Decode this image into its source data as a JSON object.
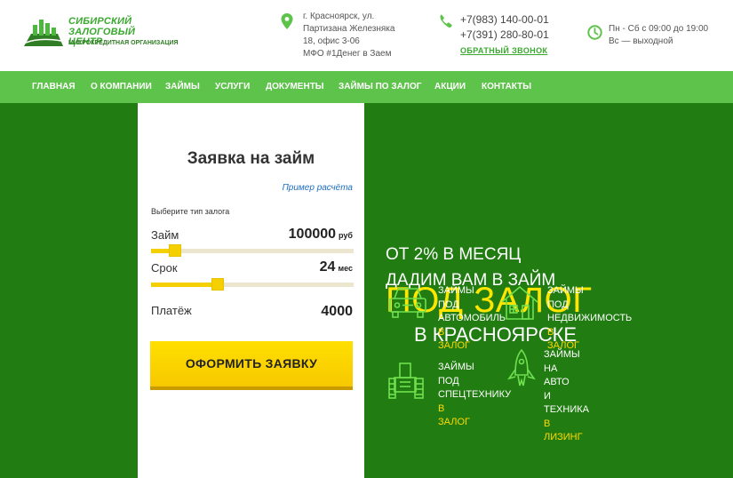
{
  "header": {
    "logo": {
      "line1": "СИБИРСКИЙ",
      "line2": "ЗАЛОГОВЫЙ ЦЕНТР",
      "line3": "МИКРОКРЕДИТНАЯ ОРГАНИЗАЦИЯ"
    },
    "address": {
      "icon": "map-pin-icon",
      "lines": [
        "г. Красноярск, ул.",
        "Партизана Железняка",
        "18, офис 3-06",
        "МФО #1Денег в Заем"
      ]
    },
    "phones": {
      "icon": "phone-icon",
      "numbers": [
        "+7(983) 140-00-01",
        "+7(391) 280-80-01"
      ],
      "callback_label": "ОБРАТНЫЙ ЗВОНОК"
    },
    "hours": {
      "icon": "clock-icon",
      "lines": [
        "Пн - Сб с 09:00 до 19:00",
        "Вс — выходной"
      ]
    }
  },
  "nav": {
    "items": [
      "ГЛАВНАЯ",
      "О КОМПАНИИ",
      "ЗАЙМЫ",
      "УСЛУГИ",
      "ДОКУМЕНТЫ",
      "ЗАЙМЫ ПО ЗАЛОГ",
      "АКЦИИ",
      "КОНТАКТЫ"
    ]
  },
  "form": {
    "title": "Заявка на займ",
    "example_link": "Пример расчёта",
    "collateral_label": "Выберите тип залога",
    "loan": {
      "label": "Займ",
      "value": "100000",
      "unit": "руб",
      "slider_fraction": 0.12
    },
    "term": {
      "label": "Срок",
      "value": "24",
      "unit": "мес",
      "slider_fraction": 0.33
    },
    "payment": {
      "label": "Платёж",
      "value": "4000"
    },
    "submit_label": "ОФОРМИТЬ ЗАЯВКУ"
  },
  "hero": {
    "line1": "ОТ 2% В МЕСЯЦ",
    "line2": "ДАДИМ ВАМ В ЗАЙМ",
    "line3": "ПОД ЗАЛОГ",
    "line4": "В КРАСНОЯРСКЕ"
  },
  "services": [
    {
      "icon": "car-icon",
      "lines": [
        "ЗАЙМЫ",
        "ПОД",
        "АВТОМОБИЛЬ"
      ],
      "accent": [
        "В",
        "ЗАЛОГ"
      ]
    },
    {
      "icon": "house-icon",
      "lines": [
        "ЗАЙМЫ",
        "ПОД",
        "НЕДВИЖИМОСТЬ"
      ],
      "accent": [
        "В",
        "ЗАЛОГ"
      ]
    },
    {
      "icon": "tractor-icon",
      "lines": [
        "ЗАЙМЫ",
        "ПОД",
        "СПЕЦТЕХНИКУ"
      ],
      "accent": [
        "В",
        "ЗАЛОГ"
      ]
    },
    {
      "icon": "rocket-icon",
      "lines": [
        "ЗАЙМЫ",
        "НА",
        "АВТО",
        "И",
        "ТЕХНИКА"
      ],
      "accent": [
        "В",
        "ЛИЗИНГ"
      ]
    }
  ],
  "colors": {
    "brand_green": "#3aa92f",
    "nav_green": "#5ec34a",
    "hero_bg": "#217d12",
    "accent_yellow": "#ffe600",
    "button_yellow": "#f7c800",
    "link_blue": "#1e6fc2"
  }
}
